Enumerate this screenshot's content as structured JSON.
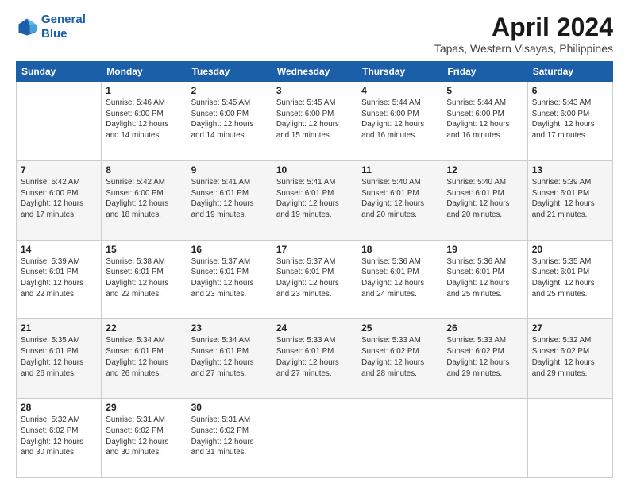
{
  "logo": {
    "line1": "General",
    "line2": "Blue"
  },
  "title": "April 2024",
  "subtitle": "Tapas, Western Visayas, Philippines",
  "days": [
    "Sunday",
    "Monday",
    "Tuesday",
    "Wednesday",
    "Thursday",
    "Friday",
    "Saturday"
  ],
  "weeks": [
    [
      {
        "date": "",
        "info": ""
      },
      {
        "date": "1",
        "info": "Sunrise: 5:46 AM\nSunset: 6:00 PM\nDaylight: 12 hours\nand 14 minutes."
      },
      {
        "date": "2",
        "info": "Sunrise: 5:45 AM\nSunset: 6:00 PM\nDaylight: 12 hours\nand 14 minutes."
      },
      {
        "date": "3",
        "info": "Sunrise: 5:45 AM\nSunset: 6:00 PM\nDaylight: 12 hours\nand 15 minutes."
      },
      {
        "date": "4",
        "info": "Sunrise: 5:44 AM\nSunset: 6:00 PM\nDaylight: 12 hours\nand 16 minutes."
      },
      {
        "date": "5",
        "info": "Sunrise: 5:44 AM\nSunset: 6:00 PM\nDaylight: 12 hours\nand 16 minutes."
      },
      {
        "date": "6",
        "info": "Sunrise: 5:43 AM\nSunset: 6:00 PM\nDaylight: 12 hours\nand 17 minutes."
      }
    ],
    [
      {
        "date": "7",
        "info": "Sunrise: 5:42 AM\nSunset: 6:00 PM\nDaylight: 12 hours\nand 17 minutes."
      },
      {
        "date": "8",
        "info": "Sunrise: 5:42 AM\nSunset: 6:00 PM\nDaylight: 12 hours\nand 18 minutes."
      },
      {
        "date": "9",
        "info": "Sunrise: 5:41 AM\nSunset: 6:01 PM\nDaylight: 12 hours\nand 19 minutes."
      },
      {
        "date": "10",
        "info": "Sunrise: 5:41 AM\nSunset: 6:01 PM\nDaylight: 12 hours\nand 19 minutes."
      },
      {
        "date": "11",
        "info": "Sunrise: 5:40 AM\nSunset: 6:01 PM\nDaylight: 12 hours\nand 20 minutes."
      },
      {
        "date": "12",
        "info": "Sunrise: 5:40 AM\nSunset: 6:01 PM\nDaylight: 12 hours\nand 20 minutes."
      },
      {
        "date": "13",
        "info": "Sunrise: 5:39 AM\nSunset: 6:01 PM\nDaylight: 12 hours\nand 21 minutes."
      }
    ],
    [
      {
        "date": "14",
        "info": "Sunrise: 5:39 AM\nSunset: 6:01 PM\nDaylight: 12 hours\nand 22 minutes."
      },
      {
        "date": "15",
        "info": "Sunrise: 5:38 AM\nSunset: 6:01 PM\nDaylight: 12 hours\nand 22 minutes."
      },
      {
        "date": "16",
        "info": "Sunrise: 5:37 AM\nSunset: 6:01 PM\nDaylight: 12 hours\nand 23 minutes."
      },
      {
        "date": "17",
        "info": "Sunrise: 5:37 AM\nSunset: 6:01 PM\nDaylight: 12 hours\nand 23 minutes."
      },
      {
        "date": "18",
        "info": "Sunrise: 5:36 AM\nSunset: 6:01 PM\nDaylight: 12 hours\nand 24 minutes."
      },
      {
        "date": "19",
        "info": "Sunrise: 5:36 AM\nSunset: 6:01 PM\nDaylight: 12 hours\nand 25 minutes."
      },
      {
        "date": "20",
        "info": "Sunrise: 5:35 AM\nSunset: 6:01 PM\nDaylight: 12 hours\nand 25 minutes."
      }
    ],
    [
      {
        "date": "21",
        "info": "Sunrise: 5:35 AM\nSunset: 6:01 PM\nDaylight: 12 hours\nand 26 minutes."
      },
      {
        "date": "22",
        "info": "Sunrise: 5:34 AM\nSunset: 6:01 PM\nDaylight: 12 hours\nand 26 minutes."
      },
      {
        "date": "23",
        "info": "Sunrise: 5:34 AM\nSunset: 6:01 PM\nDaylight: 12 hours\nand 27 minutes."
      },
      {
        "date": "24",
        "info": "Sunrise: 5:33 AM\nSunset: 6:01 PM\nDaylight: 12 hours\nand 27 minutes."
      },
      {
        "date": "25",
        "info": "Sunrise: 5:33 AM\nSunset: 6:02 PM\nDaylight: 12 hours\nand 28 minutes."
      },
      {
        "date": "26",
        "info": "Sunrise: 5:33 AM\nSunset: 6:02 PM\nDaylight: 12 hours\nand 29 minutes."
      },
      {
        "date": "27",
        "info": "Sunrise: 5:32 AM\nSunset: 6:02 PM\nDaylight: 12 hours\nand 29 minutes."
      }
    ],
    [
      {
        "date": "28",
        "info": "Sunrise: 5:32 AM\nSunset: 6:02 PM\nDaylight: 12 hours\nand 30 minutes."
      },
      {
        "date": "29",
        "info": "Sunrise: 5:31 AM\nSunset: 6:02 PM\nDaylight: 12 hours\nand 30 minutes."
      },
      {
        "date": "30",
        "info": "Sunrise: 5:31 AM\nSunset: 6:02 PM\nDaylight: 12 hours\nand 31 minutes."
      },
      {
        "date": "",
        "info": ""
      },
      {
        "date": "",
        "info": ""
      },
      {
        "date": "",
        "info": ""
      },
      {
        "date": "",
        "info": ""
      }
    ]
  ]
}
